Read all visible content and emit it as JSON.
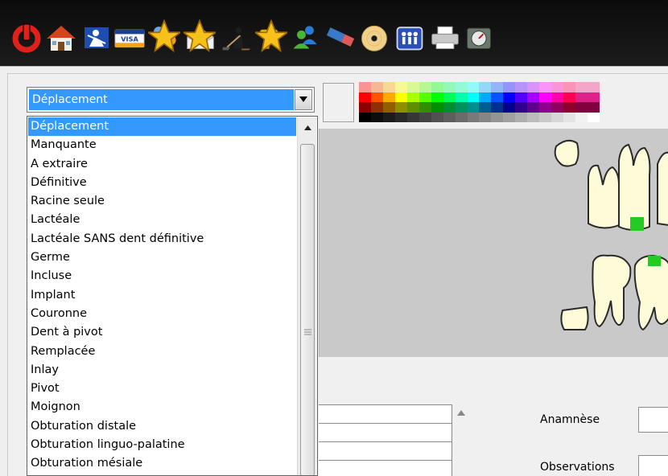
{
  "toolbar": {
    "icons": [
      "power-icon",
      "home-icon",
      "medical-staff-icon",
      "visa-card-icon",
      "pill-icon",
      "envelope-icon",
      "worker-shovel-icon",
      "drill-icon",
      "users-icon",
      "eraser-icon",
      "disc-icon",
      "team-icon",
      "printer-icon",
      "gauge-icon"
    ],
    "card_text": "VISA"
  },
  "combo": {
    "value": "Déplacement"
  },
  "dropdown": {
    "items": [
      "Déplacement",
      "Manquante",
      "A extraire",
      "Définitive",
      "Racine seule",
      "Lactéale",
      "Lactéale SANS dent définitive",
      "Germe",
      "Incluse",
      "Implant",
      "Couronne",
      "Dent à pivot",
      "Remplacée",
      "Inlay",
      "Pivot",
      "Moignon",
      "Obturation distale",
      "Obturation linguo-palatine",
      "Obturation mésiale"
    ],
    "selected_index": 0
  },
  "form": {
    "anamnese_label": "Anamnèse",
    "observations_label": "Observations"
  },
  "colors": {
    "selection": "#3399ff",
    "marker": "#22cc22",
    "tooth_fill": "#fdfbd8",
    "chart_bg": "#c9c9c9"
  }
}
